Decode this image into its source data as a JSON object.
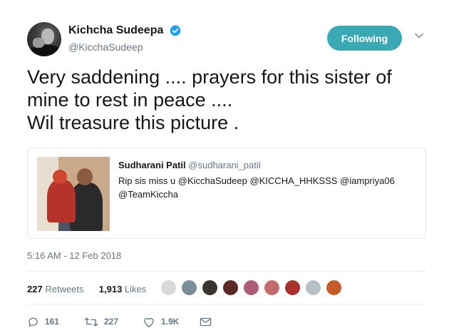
{
  "author": {
    "display_name": "Kichcha Sudeepa",
    "handle": "@KicchaSudeep",
    "verified": true
  },
  "follow_button": {
    "label": "Following",
    "color": "#3aa9b3"
  },
  "tweet": {
    "text": "Very saddening ....  prayers for this sister of\nmine to rest in peace ....\nWil treasure this picture ."
  },
  "quoted_tweet": {
    "display_name": "Sudharani Patil",
    "handle": "@sudharani_patil",
    "text": "Rip sis miss u @KicchaSudeep @KICCHA_HHKSSS @iampriya06 @TeamKiccha"
  },
  "timestamp": "5:16 AM - 12 Feb 2018",
  "stats": {
    "retweets_count": "227",
    "retweets_label": "Retweets",
    "likes_count": "1,913",
    "likes_label": "Likes"
  },
  "actions": {
    "reply_count": "161",
    "retweet_count": "227",
    "like_count": "1.9K"
  },
  "colors": {
    "text": "#14171a",
    "secondary": "#657786",
    "verified": "#1da1f2",
    "divider": "#e6ecf0"
  }
}
